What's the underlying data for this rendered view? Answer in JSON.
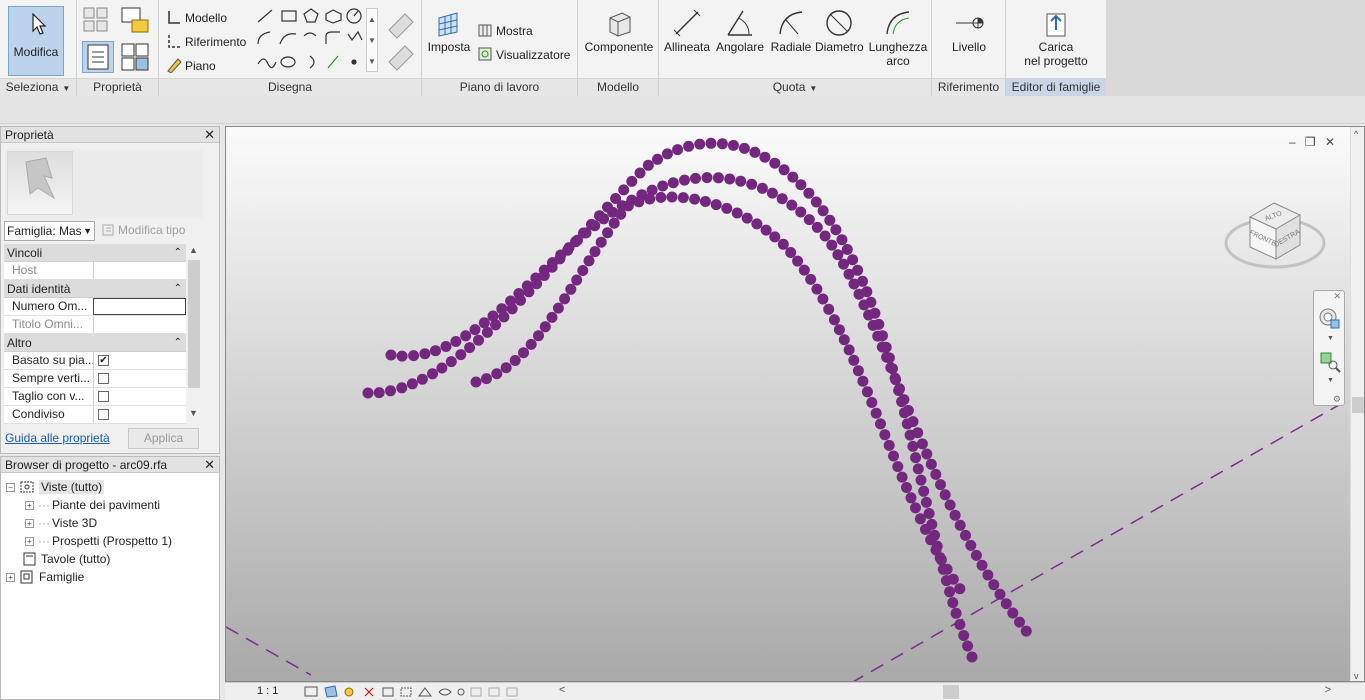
{
  "ribbon": {
    "modifica_label": "Modifica",
    "panels": {
      "seleziona": "Seleziona",
      "proprieta": "Proprietà",
      "disegna": "Disegna",
      "piano_lavoro": "Piano di lavoro",
      "modello": "Modello",
      "quota": "Quota",
      "riferimento": "Riferimento",
      "editor_famiglie": "Editor di famiglie"
    },
    "disegna_items": {
      "modello": "Modello",
      "riferimento": "Riferimento",
      "piano": "Piano"
    },
    "piano_items": {
      "imposta": "Imposta",
      "mostra": "Mostra",
      "visualizzatore": "Visualizzatore"
    },
    "componente": "Componente",
    "quota_items": {
      "allineata": "Allineata",
      "angolare": "Angolare",
      "radiale": "Radiale",
      "diametro": "Diametro",
      "lunghezza_1": "Lunghezza",
      "lunghezza_2": "arco"
    },
    "livello": "Livello",
    "carica_1": "Carica",
    "carica_2": "nel progetto"
  },
  "properties": {
    "title": "Proprietà",
    "family_select": "Famiglia: Mas",
    "modifica_tipo": "Modifica tipo",
    "sections": {
      "vincoli": "Vincoli",
      "dati_identita": "Dati identità",
      "altro": "Altro"
    },
    "rows": {
      "host": "Host",
      "numero": "Numero Om...",
      "titolo": "Titolo Omni...",
      "basato": "Basato su pia...",
      "sempre": "Sempre verti...",
      "taglio": "Taglio con v...",
      "condiviso": "Condiviso"
    },
    "checkboxes": {
      "basato": true,
      "sempre": false,
      "taglio": false,
      "condiviso": false
    },
    "help_link": "Guida alle proprietà",
    "apply_button": "Applica"
  },
  "browser": {
    "title": "Browser di progetto - arc09.rfa",
    "nodes": {
      "viste": "Viste (tutto)",
      "piante": "Piante dei pavimenti",
      "viste3d": "Viste 3D",
      "prospetti": "Prospetti (Prospetto 1)",
      "tavole": "Tavole (tutto)",
      "famiglie": "Famiglie"
    }
  },
  "viewcube": {
    "top": "ALTO",
    "front": "FRONTE",
    "right": "DESTRA"
  },
  "status": {
    "scale": "1 : 1"
  },
  "colors": {
    "curve": "#73277f",
    "selection": "#bcd3ec",
    "ref_line": "#7b2d8e"
  }
}
